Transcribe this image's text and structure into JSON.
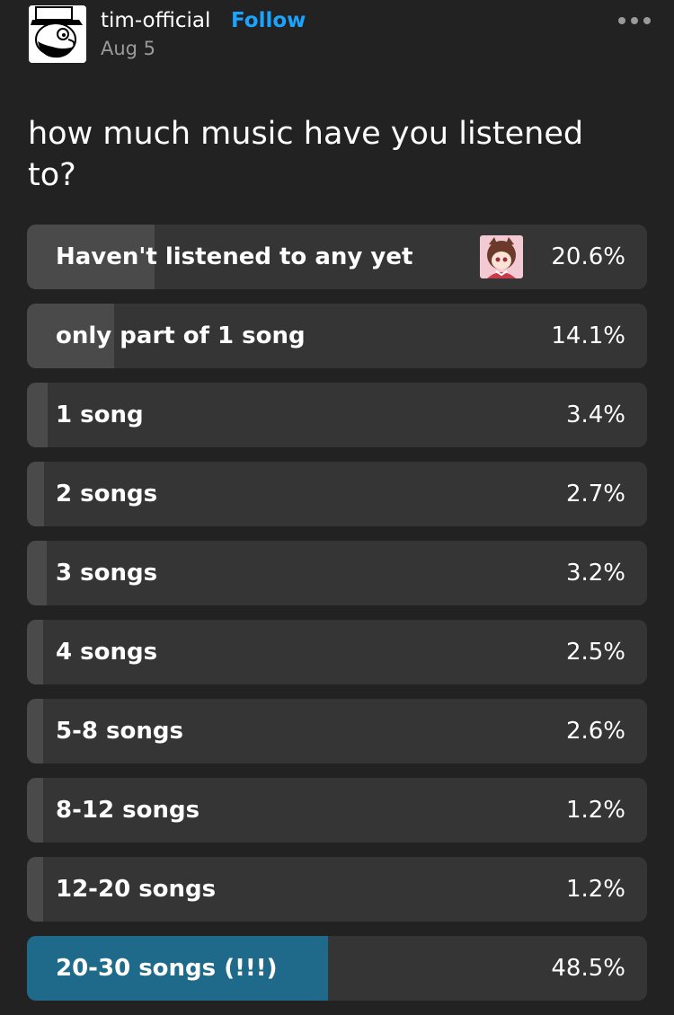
{
  "post": {
    "username": "tim-official",
    "follow_label": "Follow",
    "date": "Aug 5",
    "avatar_icon": "hatted-man-avatar",
    "more_icon": "more-dots-icon",
    "question": "how much music have you listened to?"
  },
  "poll": {
    "options": [
      {
        "label": "Haven't listened to any yet",
        "percent_text": "20.6%",
        "percent": 20.6,
        "has_voter_avatar": true
      },
      {
        "label": "only part of 1 song",
        "percent_text": "14.1%",
        "percent": 14.1
      },
      {
        "label": "1 song",
        "percent_text": "3.4%",
        "percent": 3.4
      },
      {
        "label": "2 songs",
        "percent_text": "2.7%",
        "percent": 2.7
      },
      {
        "label": "3 songs",
        "percent_text": "3.2%",
        "percent": 3.2
      },
      {
        "label": "4 songs",
        "percent_text": "2.5%",
        "percent": 2.5
      },
      {
        "label": "5-8 songs",
        "percent_text": "2.6%",
        "percent": 2.6
      },
      {
        "label": "8-12 songs",
        "percent_text": "1.2%",
        "percent": 1.2
      },
      {
        "label": "12-20 songs",
        "percent_text": "1.2%",
        "percent": 1.2
      },
      {
        "label": "20-30 songs (!!!)",
        "percent_text": "48.5%",
        "percent": 48.5,
        "winner": true
      }
    ]
  },
  "colors": {
    "background": "#222222",
    "option_bg": "#353535",
    "option_fill": "#4a4a4a",
    "winner_fill": "#1f6a8a",
    "follow": "#1aa3ff",
    "muted": "#9a9a9a"
  }
}
